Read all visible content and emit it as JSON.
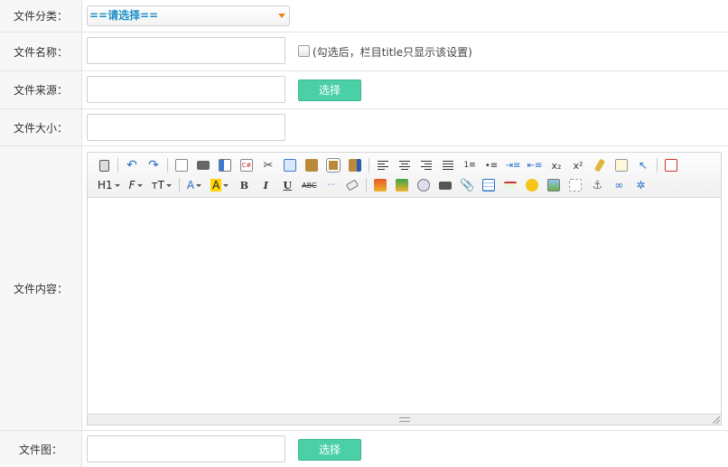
{
  "form": {
    "category": {
      "label": "文件分类：",
      "selected": "==请选择=="
    },
    "name": {
      "label": "文件名称：",
      "value": "",
      "checkbox_label": "(勾选后，栏目title只显示该设置)"
    },
    "source": {
      "label": "文件来源：",
      "value": "",
      "button": "选择"
    },
    "size": {
      "label": "文件大小：",
      "value": ""
    },
    "content": {
      "label": "文件内容："
    },
    "image": {
      "label": "文件图：",
      "value": "",
      "button": "选择"
    }
  },
  "editor": {
    "heading_label": "H1",
    "font_label": "F",
    "size_label": "тT",
    "font_color_label": "A",
    "bg_color_label": "A",
    "bold": "B",
    "italic": "I",
    "underline": "U",
    "strike": "ABC",
    "subscript": "x₂",
    "superscript": "x²"
  },
  "colors": {
    "button": "#4bcfa6",
    "select_text": "#1c8ec6",
    "label_bg": "#f7f7f7",
    "border": "#e3e3e3"
  }
}
